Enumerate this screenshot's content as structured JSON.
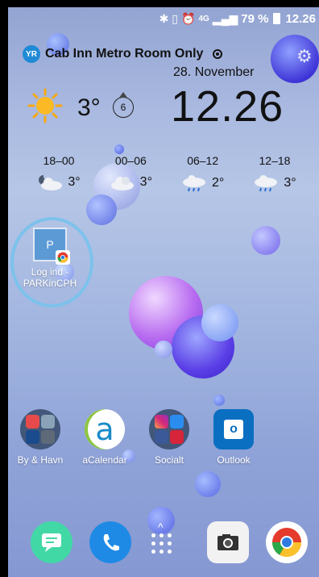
{
  "statusbar": {
    "icons": [
      "bluetooth-icon",
      "vibrate-icon",
      "alarm-icon",
      "4g-icon",
      "signal-icon"
    ],
    "network": "4G",
    "battery": "79 %",
    "time": "12.26"
  },
  "weather_widget": {
    "provider_logo": "YR",
    "location": "Cab Inn Metro Room Only",
    "date": "28. November",
    "current_temp": "3°",
    "wind_speed": "6",
    "clock": "12.26",
    "forecast": [
      {
        "time": "18–00",
        "icon": "partly-cloudy-night-icon",
        "temp": "3°"
      },
      {
        "time": "00–06",
        "icon": "cloudy-icon",
        "temp": "3°"
      },
      {
        "time": "06–12",
        "icon": "rain-cloud-icon",
        "temp": "2°"
      },
      {
        "time": "12–18",
        "icon": "rain-cloud-icon",
        "temp": "3°"
      }
    ]
  },
  "home": {
    "shortcut": {
      "tile_letter": "P",
      "label_line1": "Log ind -",
      "label_line2": "PARKinCPH"
    },
    "apps": [
      {
        "label": "By & Havn"
      },
      {
        "label": "aCalendar",
        "glyph": "a"
      },
      {
        "label": "Socialt"
      },
      {
        "label": "Outlook",
        "glyph": "o"
      }
    ]
  },
  "dock": {
    "apps": [
      "messages-icon",
      "phone-icon",
      "app-drawer-icon",
      "camera-icon",
      "chrome-icon"
    ]
  },
  "colors": {
    "accent_blue": "#1f8ad6",
    "shortcut_highlight": "#7cc2ec"
  }
}
